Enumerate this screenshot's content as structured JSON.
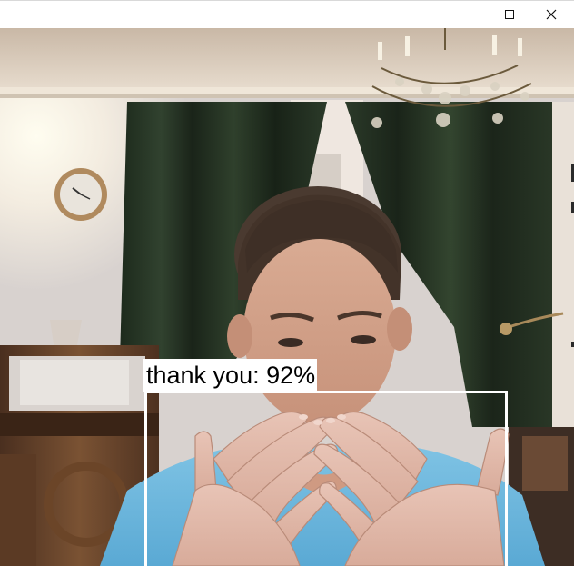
{
  "window": {
    "controls": {
      "minimize_icon": "minimize-icon",
      "maximize_icon": "maximize-icon",
      "close_icon": "close-icon"
    }
  },
  "detection": {
    "label": "thank you: 92%",
    "box_color": "#ffffff",
    "label_bg": "#ffffff",
    "label_color": "#000000"
  }
}
